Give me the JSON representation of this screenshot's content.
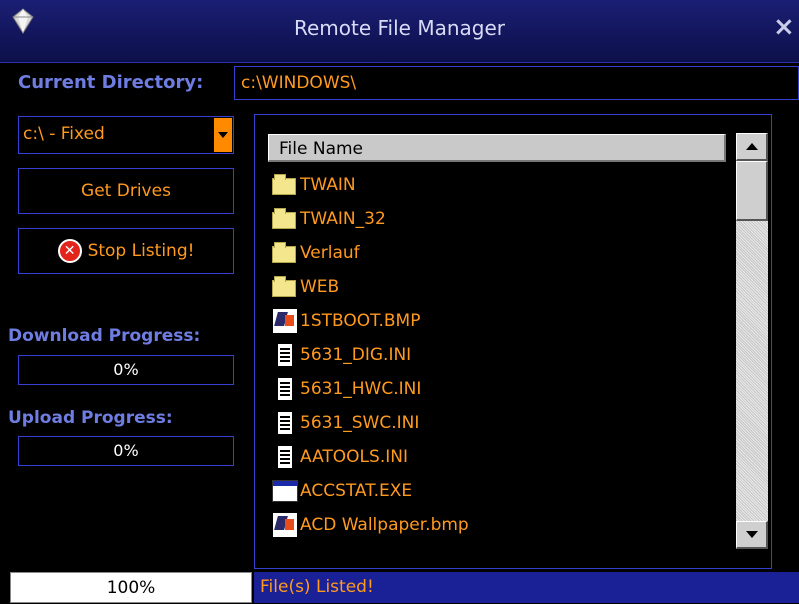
{
  "window": {
    "title": "Remote File Manager",
    "close_label": "×",
    "app_icon": "diamond-icon"
  },
  "directory": {
    "label": "Current Directory:",
    "value": "c:\\WINDOWS\\"
  },
  "drive": {
    "selected": "c:\\ - Fixed"
  },
  "buttons": {
    "get_drives": "Get Drives",
    "stop_listing": "Stop Listing!"
  },
  "download": {
    "label": "Download Progress:",
    "value": "0%"
  },
  "upload": {
    "label": "Upload Progress:",
    "value": "0%"
  },
  "file_list": {
    "column_header": "File Name",
    "rows": [
      {
        "name": "TWAIN",
        "icon": "folder-icon"
      },
      {
        "name": "TWAIN_32",
        "icon": "folder-icon"
      },
      {
        "name": "Verlauf",
        "icon": "folder-icon"
      },
      {
        "name": "WEB",
        "icon": "folder-icon"
      },
      {
        "name": "1STBOOT.BMP",
        "icon": "bitmap-file-icon"
      },
      {
        "name": "5631_DIG.INI",
        "icon": "text-file-icon"
      },
      {
        "name": "5631_HWC.INI",
        "icon": "text-file-icon"
      },
      {
        "name": "5631_SWC.INI",
        "icon": "text-file-icon"
      },
      {
        "name": "AATOOLS.INI",
        "icon": "text-file-icon"
      },
      {
        "name": "ACCSTAT.EXE",
        "icon": "executable-file-icon"
      },
      {
        "name": "ACD Wallpaper.bmp",
        "icon": "bitmap-file-icon"
      }
    ]
  },
  "status": {
    "progress": "100%",
    "message": "File(s) Listed!"
  },
  "colors": {
    "accent": "#ff9a1f",
    "label_blue": "#6f7de2",
    "border_blue": "#3540d0",
    "title_bar": "#1b1f74"
  }
}
